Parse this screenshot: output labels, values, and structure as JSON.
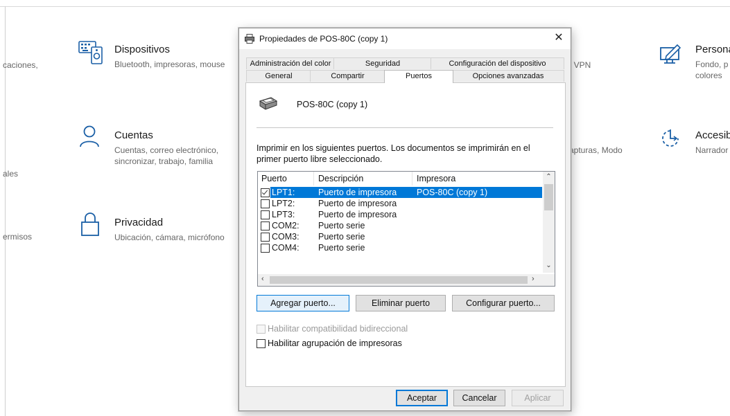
{
  "background": {
    "left_cut": [
      "caciones,",
      "ales",
      "ermisos"
    ],
    "items": [
      {
        "title": "Dispositivos",
        "sub": [
          "Bluetooth, impresoras, mouse"
        ],
        "icon": "keyboard-speaker-icon"
      },
      {
        "title": "Cuentas",
        "sub": [
          "Cuentas, correo electrónico,",
          "sincronizar, trabajo, familia"
        ],
        "icon": "person-icon"
      },
      {
        "title": "Privacidad",
        "sub": [
          "Ubicación, cámara, micrófono"
        ],
        "icon": "lock-icon"
      }
    ],
    "mid_cut": [
      ", VPN",
      "apturas, Modo"
    ],
    "right_items": [
      {
        "title": "Persona",
        "sub": [
          "Fondo, p",
          "colores"
        ],
        "icon": "pen-tablet-icon"
      },
      {
        "title": "Accesib",
        "sub": [
          "Narrador"
        ],
        "icon": "timer-icon"
      }
    ]
  },
  "dialog": {
    "title": "Propiedades de POS-80C (copy 1)",
    "close": "✕",
    "tabs_row1": [
      "Administración del color",
      "Seguridad",
      "Configuración del dispositivo"
    ],
    "tabs_row2": [
      "General",
      "Compartir",
      "Puertos",
      "Opciones avanzadas"
    ],
    "selected_tab": "Puertos",
    "printer_name": "POS-80C (copy 1)",
    "description": "Imprimir en los siguientes puertos. Los documentos se imprimirán en el primer puerto libre seleccionado.",
    "columns": [
      "Puerto",
      "Descripción",
      "Impresora"
    ],
    "ports": [
      {
        "port": "LPT1:",
        "desc": "Puerto de impresora",
        "printer": "POS-80C (copy 1)",
        "checked": true,
        "selected": true
      },
      {
        "port": "LPT2:",
        "desc": "Puerto de impresora",
        "printer": "",
        "checked": false,
        "selected": false
      },
      {
        "port": "LPT3:",
        "desc": "Puerto de impresora",
        "printer": "",
        "checked": false,
        "selected": false
      },
      {
        "port": "COM2:",
        "desc": "Puerto serie",
        "printer": "",
        "checked": false,
        "selected": false
      },
      {
        "port": "COM3:",
        "desc": "Puerto serie",
        "printer": "",
        "checked": false,
        "selected": false
      },
      {
        "port": "COM4:",
        "desc": "Puerto serie",
        "printer": "",
        "checked": false,
        "selected": false
      }
    ],
    "buttons": {
      "add_port": "Agregar puerto...",
      "delete_port": "Eliminar puerto",
      "configure_port": "Configurar puerto..."
    },
    "bidirectional": "Habilitar compatibilidad bidireccional",
    "pooling": "Habilitar agrupación de impresoras",
    "footer": {
      "ok": "Aceptar",
      "cancel": "Cancelar",
      "apply": "Aplicar"
    },
    "colors": {
      "accent": "#0078d7"
    }
  }
}
